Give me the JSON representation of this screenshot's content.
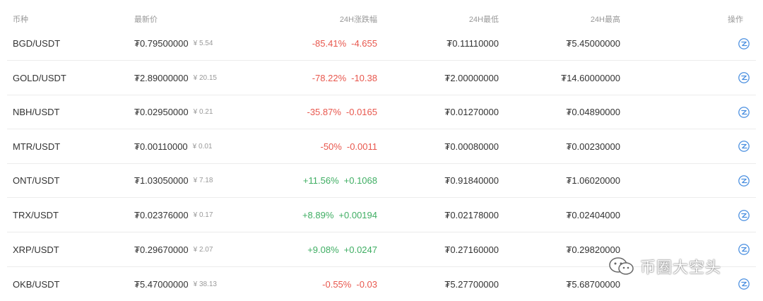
{
  "header": {
    "symbol": "币种",
    "price": "最新价",
    "change": "24H涨跌幅",
    "low": "24H最低",
    "high": "24H最高",
    "action": "操作"
  },
  "rows": [
    {
      "symbol": "BGD/USDT",
      "price": "₮0.79500000",
      "cny": "¥ 5.54",
      "change_pct": "-85.41%",
      "change_abs": "-4.655",
      "low": "₮0.11110000",
      "high": "₮5.45000000",
      "trend": "down"
    },
    {
      "symbol": "GOLD/USDT",
      "price": "₮2.89000000",
      "cny": "¥ 20.15",
      "change_pct": "-78.22%",
      "change_abs": "-10.38",
      "low": "₮2.00000000",
      "high": "₮14.60000000",
      "trend": "down"
    },
    {
      "symbol": "NBH/USDT",
      "price": "₮0.02950000",
      "cny": "¥ 0.21",
      "change_pct": "-35.87%",
      "change_abs": "-0.0165",
      "low": "₮0.01270000",
      "high": "₮0.04890000",
      "trend": "down"
    },
    {
      "symbol": "MTR/USDT",
      "price": "₮0.00110000",
      "cny": "¥ 0.01",
      "change_pct": "-50%",
      "change_abs": "-0.0011",
      "low": "₮0.00080000",
      "high": "₮0.00230000",
      "trend": "down"
    },
    {
      "symbol": "ONT/USDT",
      "price": "₮1.03050000",
      "cny": "¥ 7.18",
      "change_pct": "+11.56%",
      "change_abs": "+0.1068",
      "low": "₮0.91840000",
      "high": "₮1.06020000",
      "trend": "up"
    },
    {
      "symbol": "TRX/USDT",
      "price": "₮0.02376000",
      "cny": "¥ 0.17",
      "change_pct": "+8.89%",
      "change_abs": "+0.00194",
      "low": "₮0.02178000",
      "high": "₮0.02404000",
      "trend": "up"
    },
    {
      "symbol": "XRP/USDT",
      "price": "₮0.29670000",
      "cny": "¥ 2.07",
      "change_pct": "+9.08%",
      "change_abs": "+0.0247",
      "low": "₮0.27160000",
      "high": "₮0.29820000",
      "trend": "up"
    },
    {
      "symbol": "OKB/USDT",
      "price": "₮5.47000000",
      "cny": "¥ 38.13",
      "change_pct": "-0.55%",
      "change_abs": "-0.03",
      "low": "₮5.27700000",
      "high": "₮5.68700000",
      "trend": "down"
    }
  ],
  "action_icon": "trade-icon",
  "watermark": {
    "text": "币圈大空头",
    "icon": "wechat-icon"
  },
  "colors": {
    "down": "#e8574d",
    "up": "#3fae63",
    "accent": "#4a8fe0"
  }
}
